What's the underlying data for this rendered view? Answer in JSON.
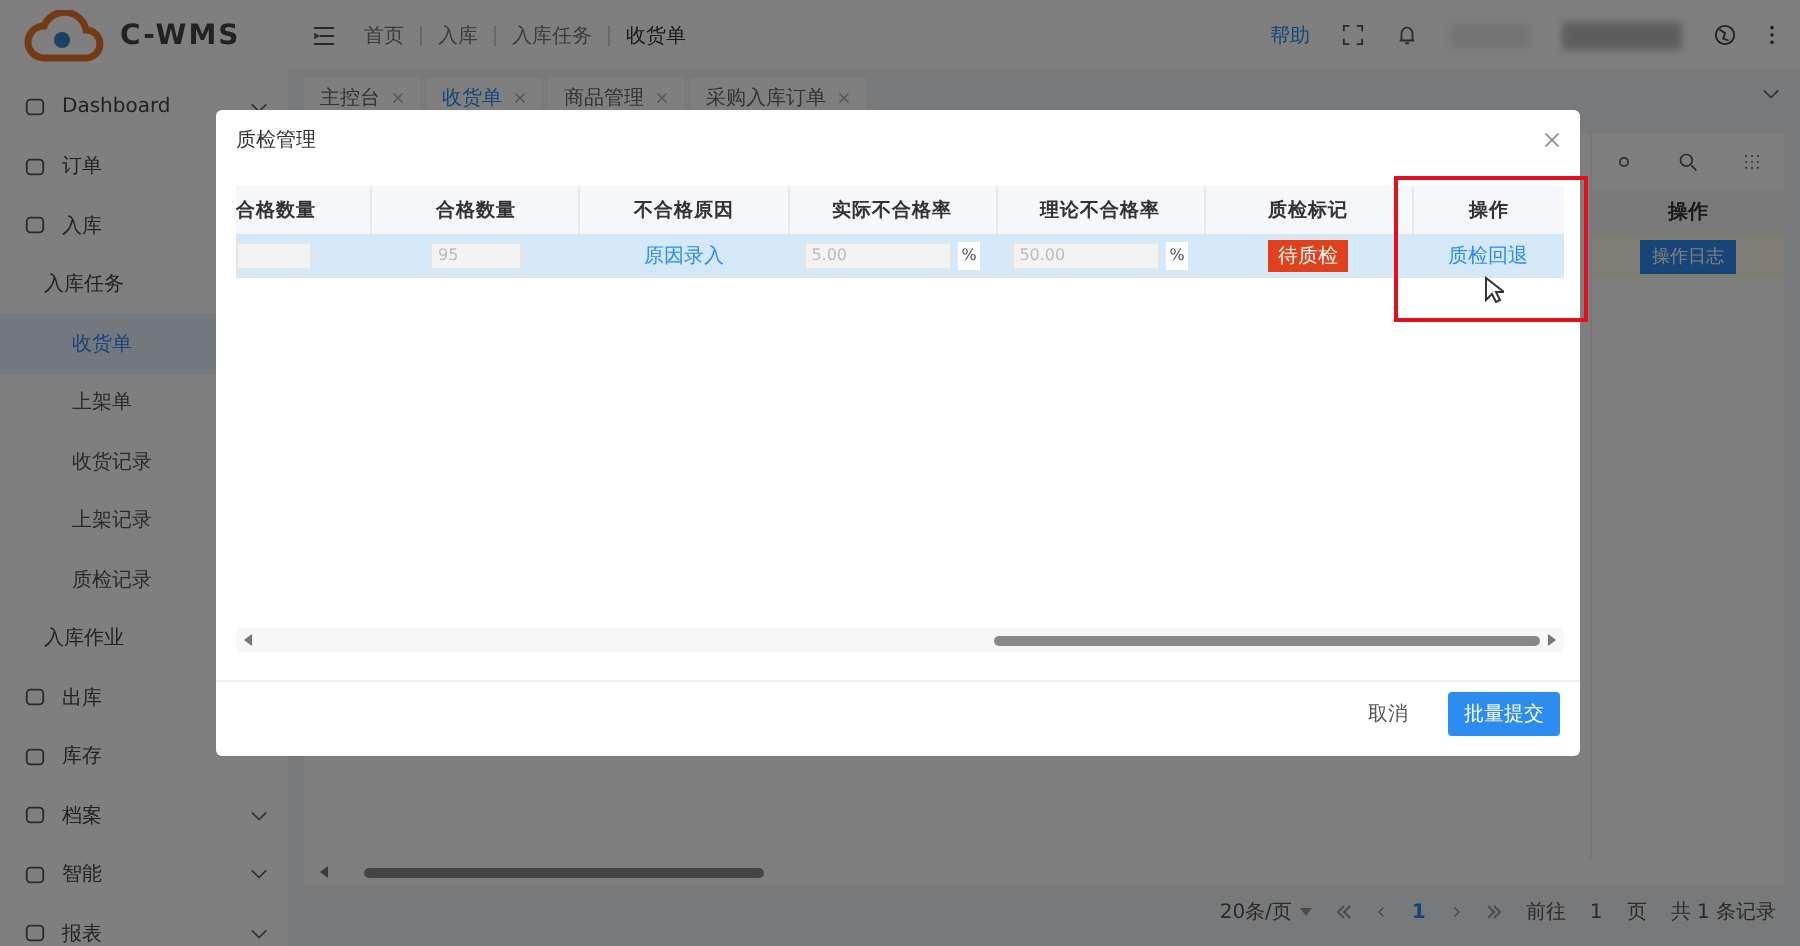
{
  "header": {
    "logo": "C-WMS",
    "breadcrumbs": [
      "首页",
      "入库",
      "入库任务",
      "收货单"
    ],
    "help": "帮助"
  },
  "sidebar": {
    "items": [
      {
        "label": "Dashboard",
        "expandable": true,
        "selected": false
      },
      {
        "label": "订单",
        "selected": false
      },
      {
        "label": "入库",
        "selected": false,
        "children": [
          {
            "label": "入库任务",
            "selected": false,
            "children": [
              {
                "label": "收货单",
                "selected": true
              },
              {
                "label": "上架单",
                "selected": false
              },
              {
                "label": "收货记录",
                "selected": false
              },
              {
                "label": "上架记录",
                "selected": false
              },
              {
                "label": "质检记录",
                "selected": false
              }
            ]
          },
          {
            "label": "入库作业",
            "selected": false
          }
        ]
      },
      {
        "label": "出库",
        "selected": false
      },
      {
        "label": "库存",
        "expandable": false,
        "selected": false
      },
      {
        "label": "档案",
        "expandable": true,
        "selected": false
      },
      {
        "label": "智能",
        "expandable": true,
        "selected": false
      },
      {
        "label": "报表",
        "expandable": true,
        "selected": false
      }
    ]
  },
  "tabs": [
    {
      "label": "主控台",
      "selected": false
    },
    {
      "label": "收货单",
      "selected": true
    },
    {
      "label": "商品管理",
      "selected": false
    },
    {
      "label": "采购入库订单",
      "selected": false
    }
  ],
  "background_table": {
    "column": "操作",
    "row_button": "操作日志"
  },
  "pagination": {
    "page_size": "20条/页",
    "current_page": "1",
    "goto_label": "前往",
    "goto_value": "1",
    "page_unit": "页",
    "total": "共 1 条记录"
  },
  "dialog": {
    "title": "质检管理",
    "columns": [
      "合格数量",
      "合格数量",
      "不合格原因",
      "实际不合格率",
      "理论不合格率",
      "质检标记",
      "操作"
    ],
    "rows": [
      {
        "qualified": "95",
        "reason_link": "原因录入",
        "actual_rate": "5.00",
        "actual_unit": "%",
        "theory_rate": "50.00",
        "theory_unit": "%",
        "tag": "待质检",
        "action": "质检回退",
        "selected": true
      }
    ],
    "buttons": [
      {
        "label": "取消",
        "kind": "plain"
      },
      {
        "label": "批量提交",
        "kind": "primary"
      }
    ]
  }
}
